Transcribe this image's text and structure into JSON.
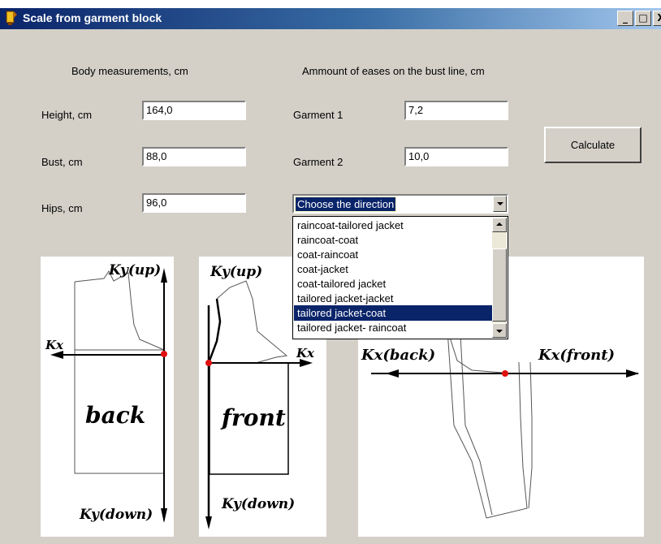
{
  "window": {
    "title": "Scale from garment block",
    "minimize": "_",
    "maximize": "□",
    "close": "X"
  },
  "body_section": {
    "header": "Body measurements, cm",
    "fields": [
      {
        "label": "Height, cm",
        "value": "164,0"
      },
      {
        "label": "Bust, cm",
        "value": "88,0"
      },
      {
        "label": "Hips, cm",
        "value": "96,0"
      }
    ]
  },
  "eases_section": {
    "header": "Ammount of eases on the bust line, cm",
    "fields": [
      {
        "label": "Garment 1",
        "value": "7,2"
      },
      {
        "label": "Garment 2",
        "value": "10,0"
      }
    ]
  },
  "calculate_label": "Calculate",
  "direction": {
    "selected": "Choose the direction",
    "options": [
      "raincoat-tailored jacket",
      "raincoat-coat",
      "coat-raincoat",
      "coat-jacket",
      "coat-tailored jacket",
      "tailored jacket-jacket",
      "tailored jacket-coat",
      "tailored jacket- raincoat"
    ],
    "highlighted": "tailored jacket-coat"
  },
  "diagrams": {
    "back": {
      "ky_up": "Ky(up)",
      "kx": "Kx",
      "name": "back",
      "ky_down": "Ky(down)"
    },
    "front": {
      "ky_up": "Ky(up)",
      "kx": "Kx",
      "name": "front",
      "ky_down": "Ky(down)"
    },
    "sleeve": {
      "kx_back": "Kx(back)",
      "kx_front": "Kx(front)"
    }
  },
  "colors": {
    "titlebar_start": "#0a246a",
    "selection": "#0a246a",
    "origin_point": "#e01010",
    "dialog_bg": "#d4d0c8"
  }
}
